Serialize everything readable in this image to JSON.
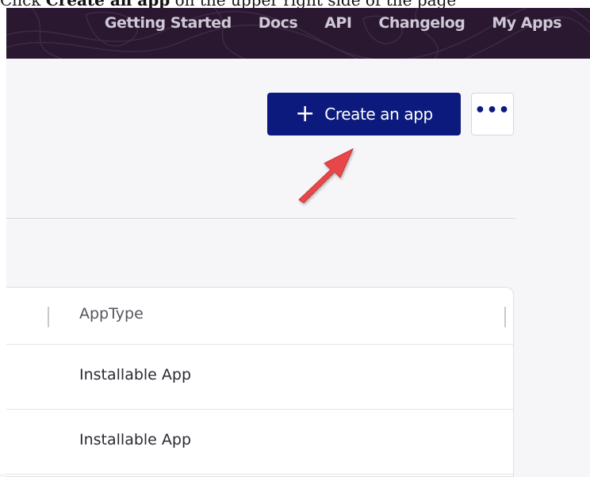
{
  "caption": {
    "prefix": "Click ",
    "bold": "Create an app",
    "suffix": " on the upper right side of the page"
  },
  "nav": {
    "links": [
      "Getting Started",
      "Docs",
      "API",
      "Changelog",
      "My Apps"
    ]
  },
  "actions": {
    "create_icon": "plus-icon",
    "create_label": "Create an app",
    "more_label": "•••"
  },
  "table": {
    "columns": [
      "AppType"
    ],
    "rows": [
      {
        "app_type": "Installable App"
      },
      {
        "app_type": "Installable App"
      }
    ]
  },
  "colors": {
    "nav_bg": "#2a1830",
    "primary": "#0c1a7e",
    "arrow": "#e8474a"
  }
}
